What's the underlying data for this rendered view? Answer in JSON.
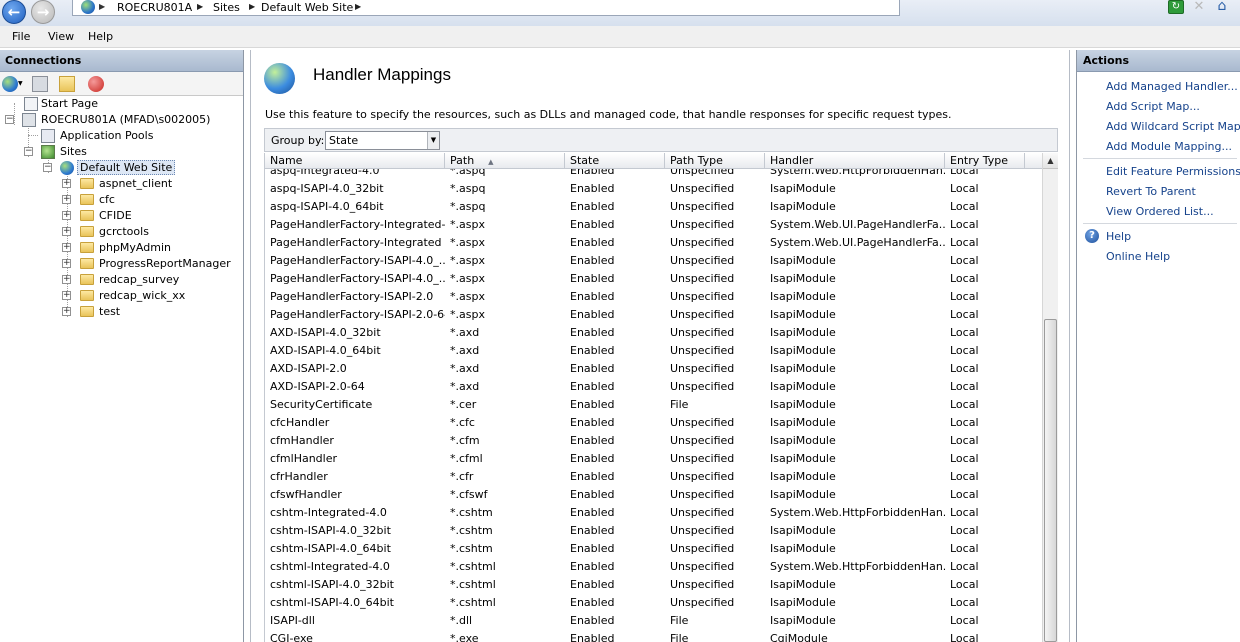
{
  "breadcrumb": [
    "ROECRU801A",
    "Sites",
    "Default Web Site"
  ],
  "menu": [
    "File",
    "View",
    "Help"
  ],
  "connections": {
    "title": "Connections",
    "tree": [
      {
        "label": "Start Page"
      },
      {
        "label": "ROECRU801A (MFAD\\s002005)"
      },
      {
        "label": "Application Pools"
      },
      {
        "label": "Sites"
      },
      {
        "label": "Default Web Site"
      },
      {
        "label": "aspnet_client"
      },
      {
        "label": "cfc"
      },
      {
        "label": "CFIDE"
      },
      {
        "label": "gcrctools"
      },
      {
        "label": "phpMyAdmin"
      },
      {
        "label": "ProgressReportManager"
      },
      {
        "label": "redcap_survey"
      },
      {
        "label": "redcap_wick_xx"
      },
      {
        "label": "test"
      }
    ]
  },
  "feature": {
    "title": "Handler Mappings",
    "description": "Use this feature to specify the resources, such as DLLs and managed code, that handle responses for specific request types.",
    "group_by_label": "Group by:",
    "group_by_value": "State"
  },
  "grid": {
    "columns": [
      "Name",
      "Path",
      "State",
      "Path Type",
      "Handler",
      "Entry Type"
    ],
    "rows": [
      [
        "aspq-Integrated-4.0",
        "*.aspq",
        "Enabled",
        "Unspecified",
        "System.Web.HttpForbiddenHan...",
        "Local"
      ],
      [
        "aspq-ISAPI-4.0_32bit",
        "*.aspq",
        "Enabled",
        "Unspecified",
        "IsapiModule",
        "Local"
      ],
      [
        "aspq-ISAPI-4.0_64bit",
        "*.aspq",
        "Enabled",
        "Unspecified",
        "IsapiModule",
        "Local"
      ],
      [
        "PageHandlerFactory-Integrated-...",
        "*.aspx",
        "Enabled",
        "Unspecified",
        "System.Web.UI.PageHandlerFa...",
        "Local"
      ],
      [
        "PageHandlerFactory-Integrated",
        "*.aspx",
        "Enabled",
        "Unspecified",
        "System.Web.UI.PageHandlerFa...",
        "Local"
      ],
      [
        "PageHandlerFactory-ISAPI-4.0_...",
        "*.aspx",
        "Enabled",
        "Unspecified",
        "IsapiModule",
        "Local"
      ],
      [
        "PageHandlerFactory-ISAPI-4.0_...",
        "*.aspx",
        "Enabled",
        "Unspecified",
        "IsapiModule",
        "Local"
      ],
      [
        "PageHandlerFactory-ISAPI-2.0",
        "*.aspx",
        "Enabled",
        "Unspecified",
        "IsapiModule",
        "Local"
      ],
      [
        "PageHandlerFactory-ISAPI-2.0-64",
        "*.aspx",
        "Enabled",
        "Unspecified",
        "IsapiModule",
        "Local"
      ],
      [
        "AXD-ISAPI-4.0_32bit",
        "*.axd",
        "Enabled",
        "Unspecified",
        "IsapiModule",
        "Local"
      ],
      [
        "AXD-ISAPI-4.0_64bit",
        "*.axd",
        "Enabled",
        "Unspecified",
        "IsapiModule",
        "Local"
      ],
      [
        "AXD-ISAPI-2.0",
        "*.axd",
        "Enabled",
        "Unspecified",
        "IsapiModule",
        "Local"
      ],
      [
        "AXD-ISAPI-2.0-64",
        "*.axd",
        "Enabled",
        "Unspecified",
        "IsapiModule",
        "Local"
      ],
      [
        "SecurityCertificate",
        "*.cer",
        "Enabled",
        "File",
        "IsapiModule",
        "Local"
      ],
      [
        "cfcHandler",
        "*.cfc",
        "Enabled",
        "Unspecified",
        "IsapiModule",
        "Local"
      ],
      [
        "cfmHandler",
        "*.cfm",
        "Enabled",
        "Unspecified",
        "IsapiModule",
        "Local"
      ],
      [
        "cfmlHandler",
        "*.cfml",
        "Enabled",
        "Unspecified",
        "IsapiModule",
        "Local"
      ],
      [
        "cfrHandler",
        "*.cfr",
        "Enabled",
        "Unspecified",
        "IsapiModule",
        "Local"
      ],
      [
        "cfswfHandler",
        "*.cfswf",
        "Enabled",
        "Unspecified",
        "IsapiModule",
        "Local"
      ],
      [
        "cshtm-Integrated-4.0",
        "*.cshtm",
        "Enabled",
        "Unspecified",
        "System.Web.HttpForbiddenHan...",
        "Local"
      ],
      [
        "cshtm-ISAPI-4.0_32bit",
        "*.cshtm",
        "Enabled",
        "Unspecified",
        "IsapiModule",
        "Local"
      ],
      [
        "cshtm-ISAPI-4.0_64bit",
        "*.cshtm",
        "Enabled",
        "Unspecified",
        "IsapiModule",
        "Local"
      ],
      [
        "cshtml-Integrated-4.0",
        "*.cshtml",
        "Enabled",
        "Unspecified",
        "System.Web.HttpForbiddenHan...",
        "Local"
      ],
      [
        "cshtml-ISAPI-4.0_32bit",
        "*.cshtml",
        "Enabled",
        "Unspecified",
        "IsapiModule",
        "Local"
      ],
      [
        "cshtml-ISAPI-4.0_64bit",
        "*.cshtml",
        "Enabled",
        "Unspecified",
        "IsapiModule",
        "Local"
      ],
      [
        "ISAPI-dll",
        "*.dll",
        "Enabled",
        "File",
        "IsapiModule",
        "Local"
      ],
      [
        "CGI-exe",
        "*.exe",
        "Enabled",
        "File",
        "CgiModule",
        "Local"
      ]
    ]
  },
  "actions": {
    "title": "Actions",
    "group1": [
      "Add Managed Handler...",
      "Add Script Map...",
      "Add Wildcard Script Map...",
      "Add Module Mapping..."
    ],
    "group2": [
      "Edit Feature Permissions...",
      "Revert To Parent",
      "View Ordered List..."
    ],
    "group3": [
      "Help",
      "Online Help"
    ]
  }
}
